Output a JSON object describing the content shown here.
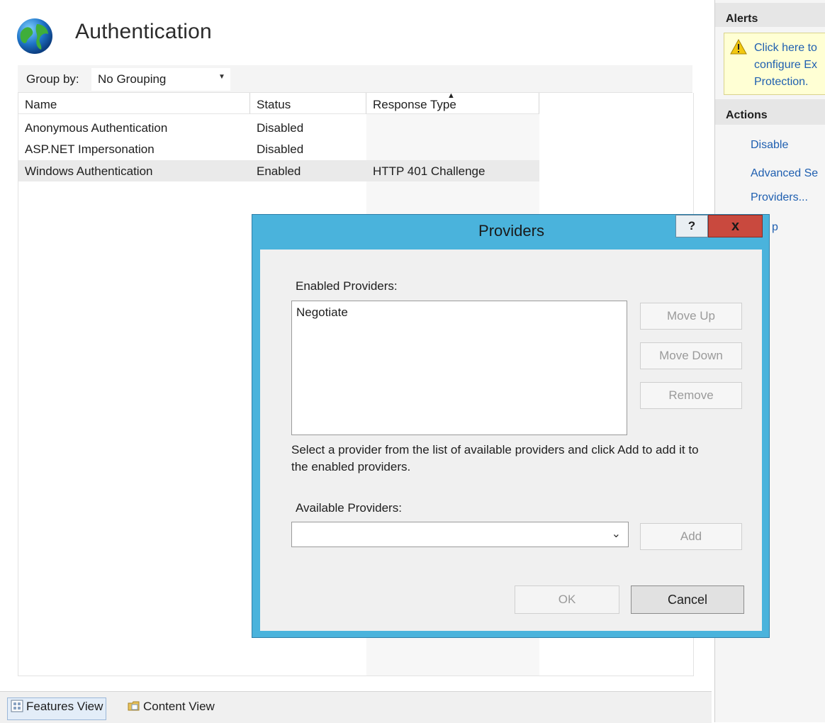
{
  "page": {
    "title": "Authentication"
  },
  "group_by": {
    "label": "Group by:",
    "value": "No Grouping"
  },
  "table": {
    "columns": [
      "Name",
      "Status",
      "Response Type"
    ],
    "rows": [
      {
        "name": "Anonymous Authentication",
        "status": "Disabled",
        "response_type": ""
      },
      {
        "name": "ASP.NET Impersonation",
        "status": "Disabled",
        "response_type": ""
      },
      {
        "name": "Windows Authentication",
        "status": "Enabled",
        "response_type": "HTTP 401 Challenge"
      }
    ],
    "selected_row": 2
  },
  "view_tabs": {
    "features": "Features View",
    "content": "Content View"
  },
  "alerts": {
    "header": "Alerts",
    "message": "Click here to\nconfigure Ex\nProtection."
  },
  "actions": {
    "header": "Actions",
    "items": [
      "Disable",
      "Advanced Se",
      "Providers...",
      "p"
    ]
  },
  "dialog": {
    "title": "Providers",
    "help": "?",
    "close": "x",
    "enabled_label": "Enabled Providers:",
    "enabled_items": [
      "Negotiate"
    ],
    "move_up": "Move Up",
    "move_down": "Move Down",
    "remove": "Remove",
    "info": "Select a provider from the list of available providers and click Add to add it to the enabled providers.",
    "available_label": "Available Providers:",
    "available_value": "",
    "add": "Add",
    "ok": "OK",
    "cancel": "Cancel"
  },
  "colors": {
    "dialog_frame": "#4ab3dc",
    "close_button": "#c9493e",
    "link": "#1f5fb0",
    "alert_bg": "#ffffd4"
  },
  "icons": {
    "page": "globe-icon",
    "alert": "warning-icon",
    "features_view": "features-view-icon",
    "content_view": "content-view-icon",
    "dropdown": "chevron-down-icon"
  }
}
